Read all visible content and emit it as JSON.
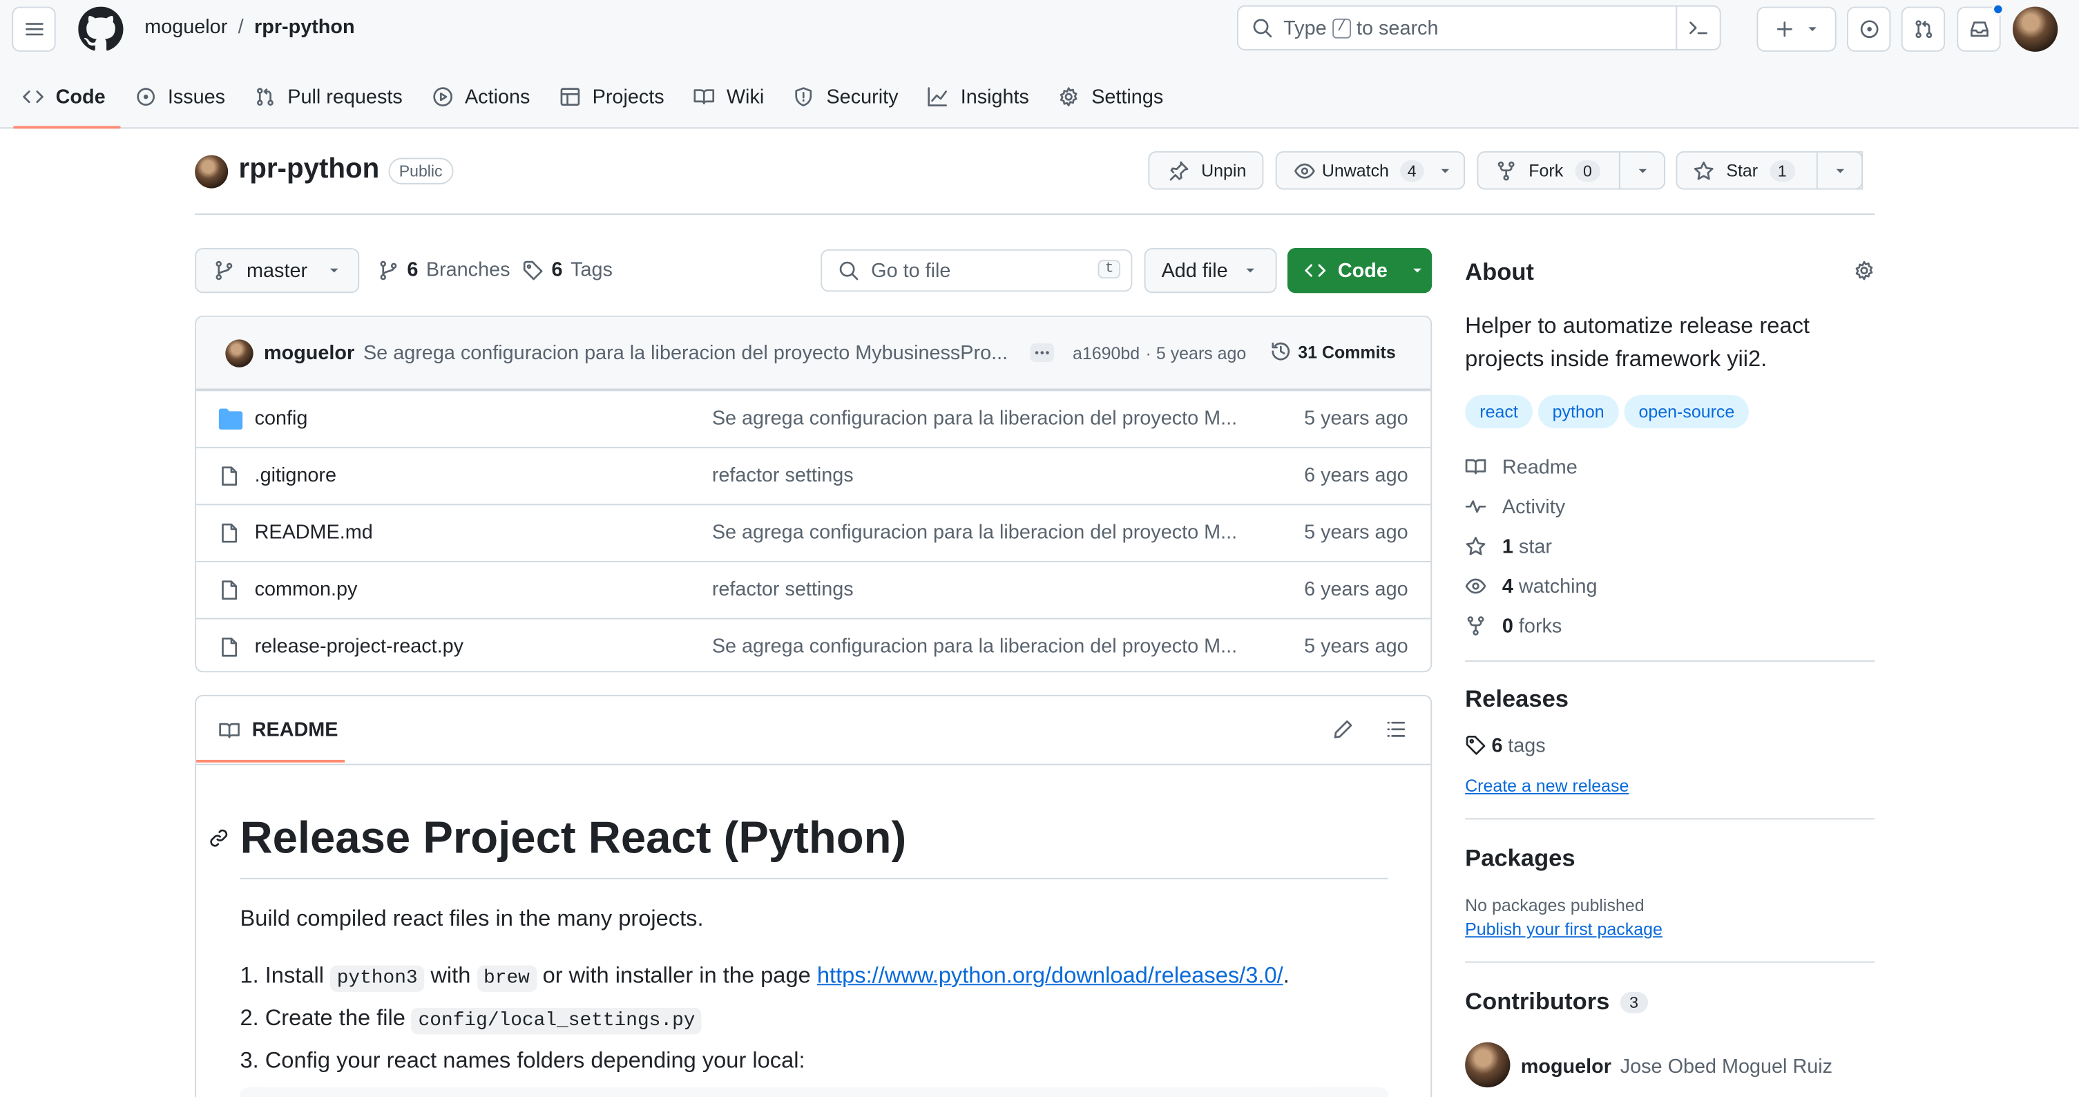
{
  "header": {
    "owner": "moguelor",
    "separator": "/",
    "repo": "rpr-python",
    "search_prefix": "Type",
    "search_key": "/",
    "search_suffix": "to search"
  },
  "tabs": [
    {
      "label": "Code",
      "icon": "code-icon"
    },
    {
      "label": "Issues",
      "icon": "issue-icon"
    },
    {
      "label": "Pull requests",
      "icon": "pull-request-icon"
    },
    {
      "label": "Actions",
      "icon": "play-icon"
    },
    {
      "label": "Projects",
      "icon": "table-icon"
    },
    {
      "label": "Wiki",
      "icon": "book-icon"
    },
    {
      "label": "Security",
      "icon": "shield-icon"
    },
    {
      "label": "Insights",
      "icon": "graph-icon"
    },
    {
      "label": "Settings",
      "icon": "gear-icon"
    }
  ],
  "repo": {
    "name": "rpr-python",
    "visibility": "Public",
    "unpin": "Unpin",
    "unwatch": "Unwatch",
    "watch_count": "4",
    "fork": "Fork",
    "fork_count": "0",
    "star": "Star",
    "star_count": "1"
  },
  "filenav": {
    "branch": "master",
    "branches_count": "6",
    "branches_label": "Branches",
    "tags_count": "6",
    "tags_label": "Tags",
    "go_to_file": "Go to file",
    "go_to_file_key": "t",
    "add_file": "Add file",
    "code": "Code"
  },
  "commit": {
    "author": "moguelor",
    "message": "Se agrega configuracion para la liberacion del proyecto MybusinessPro...",
    "hash": "a1690bd",
    "dot": "·",
    "age": "5 years ago",
    "commits": "31 Commits"
  },
  "files": [
    {
      "name": "config",
      "type": "folder",
      "message": "Se agrega configuracion para la liberacion del proyecto M...",
      "age": "5 years ago"
    },
    {
      "name": ".gitignore",
      "type": "file",
      "message": "refactor settings",
      "age": "6 years ago"
    },
    {
      "name": "README.md",
      "type": "file",
      "message": "Se agrega configuracion para la liberacion del proyecto M...",
      "age": "5 years ago"
    },
    {
      "name": "common.py",
      "type": "file",
      "message": "refactor settings",
      "age": "6 years ago"
    },
    {
      "name": "release-project-react.py",
      "type": "file",
      "message": "Se agrega configuracion para la liberacion del proyecto M...",
      "age": "5 years ago"
    }
  ],
  "readme": {
    "tab": "README",
    "title": "Release Project React (Python)",
    "intro": "Build compiled react files in the many projects.",
    "step1_pre": "Install",
    "step1_code1": "python3",
    "step1_mid": "with",
    "step1_code2": "brew",
    "step1_post": "or with installer in the page",
    "step1_link": "https://www.python.org/download/releases/3.0/",
    "step1_end": ".",
    "step2_pre": "Create the file",
    "step2_code": "config/local_settings.py",
    "step3": "Config your react names folders depending your local:"
  },
  "about": {
    "title": "About",
    "description": "Helper to automatize release react projects inside framework yii2.",
    "topics": [
      "react",
      "python",
      "open-source"
    ],
    "readme": "Readme",
    "activity": "Activity",
    "stars_count": "1",
    "stars_label": "star",
    "watching_count": "4",
    "watching_label": "watching",
    "forks_count": "0",
    "forks_label": "forks"
  },
  "releases": {
    "title": "Releases",
    "tags_count": "6",
    "tags_label": "tags",
    "create_link": "Create a new release"
  },
  "packages": {
    "title": "Packages",
    "none": "No packages published",
    "publish_link": "Publish your first package"
  },
  "contributors": {
    "title": "Contributors",
    "count": "3",
    "first_user": "moguelor",
    "first_name": "Jose Obed Moguel Ruiz"
  },
  "colors": {
    "accent_green": "#1f883d",
    "link_blue": "#0969da",
    "tab_underline": "#fd8c73",
    "notification_dot": "#0969da"
  }
}
